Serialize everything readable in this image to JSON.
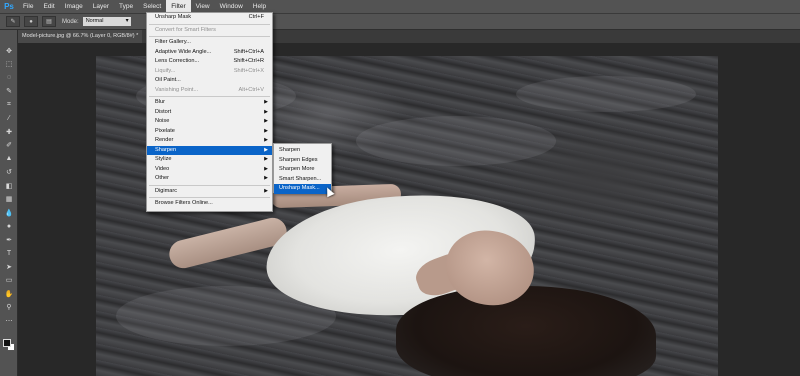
{
  "app": {
    "logo": "Ps"
  },
  "menubar": [
    "File",
    "Edit",
    "Image",
    "Layer",
    "Type",
    "Select",
    "Filter",
    "View",
    "Window",
    "Help"
  ],
  "options": {
    "mode_label": "Mode:",
    "mode_value": "Normal"
  },
  "document": {
    "tab_title": "Model-picture.jpg @ 66.7% (Layer 0, RGB/8#) *"
  },
  "filter_menu": {
    "top_item": {
      "label": "Unsharp Mask",
      "shortcut": "Ctrl+F"
    },
    "convert": "Convert for Smart Filters",
    "group1": [
      {
        "label": "Filter Gallery...",
        "shortcut": "",
        "disabled": false
      },
      {
        "label": "Adaptive Wide Angle...",
        "shortcut": "Shift+Ctrl+A",
        "disabled": false
      },
      {
        "label": "Lens Correction...",
        "shortcut": "Shift+Ctrl+R",
        "disabled": false
      },
      {
        "label": "Liquify...",
        "shortcut": "Shift+Ctrl+X",
        "disabled": true
      },
      {
        "label": "Oil Paint...",
        "shortcut": "",
        "disabled": false
      },
      {
        "label": "Vanishing Point...",
        "shortcut": "Alt+Ctrl+V",
        "disabled": true
      }
    ],
    "group2": [
      "Blur",
      "Distort",
      "Noise",
      "Pixelate",
      "Render",
      "Sharpen",
      "Stylize",
      "Video",
      "Other"
    ],
    "digimarc": "Digimarc",
    "browse": "Browse Filters Online..."
  },
  "sharpen_submenu": [
    "Sharpen",
    "Sharpen Edges",
    "Sharpen More",
    "Smart Sharpen...",
    "Unsharp Mask..."
  ],
  "tools": [
    "move",
    "marquee",
    "lasso",
    "quick-select",
    "crop",
    "eyedropper",
    "healing",
    "brush",
    "clone",
    "history",
    "eraser",
    "gradient",
    "blur",
    "dodge",
    "pen",
    "type",
    "path-select",
    "shape",
    "hand",
    "zoom",
    "more"
  ],
  "colors": {
    "highlight": "#0a64c8",
    "menubar": "#535353",
    "canvas_bg": "#282828"
  }
}
